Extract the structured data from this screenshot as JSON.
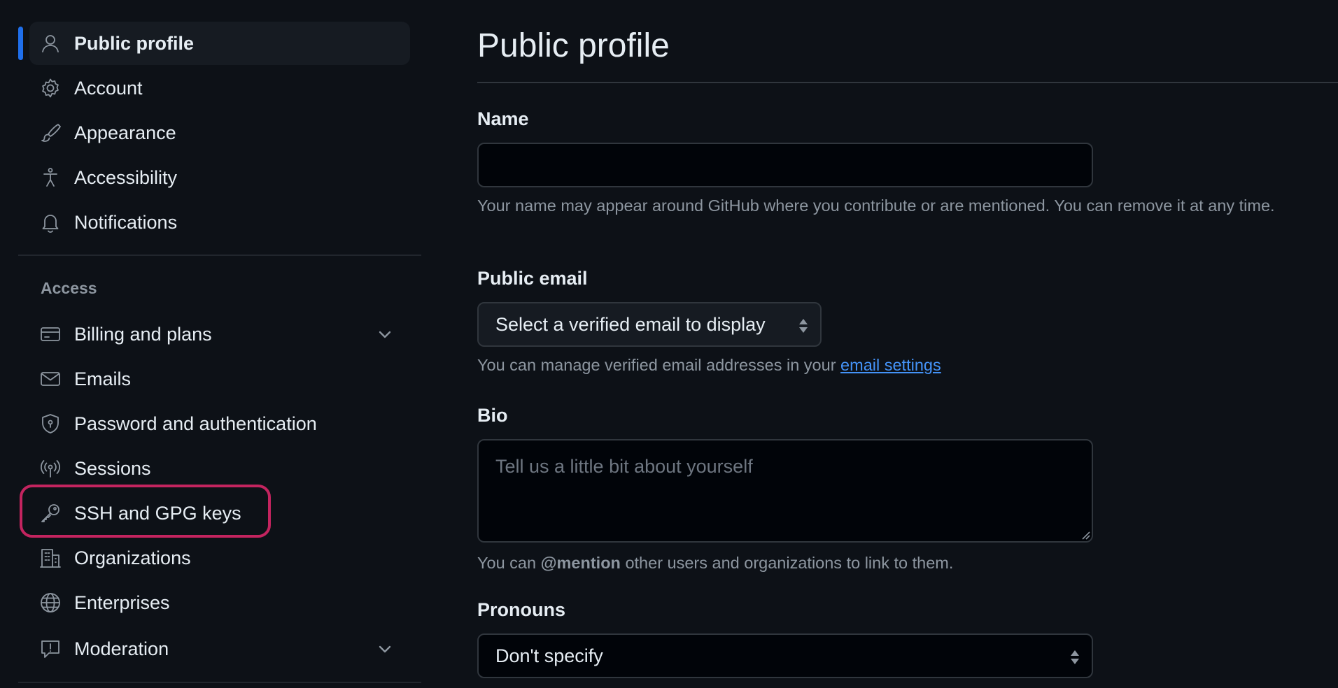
{
  "sidebar": {
    "items": [
      {
        "label": "Public profile",
        "icon": "person-icon",
        "active": true
      },
      {
        "label": "Account",
        "icon": "gear-icon"
      },
      {
        "label": "Appearance",
        "icon": "paintbrush-icon"
      },
      {
        "label": "Accessibility",
        "icon": "accessibility-icon"
      },
      {
        "label": "Notifications",
        "icon": "bell-icon"
      }
    ],
    "access_heading": "Access",
    "access_items": [
      {
        "label": "Billing and plans",
        "icon": "credit-card-icon",
        "has_chevron": true
      },
      {
        "label": "Emails",
        "icon": "mail-icon"
      },
      {
        "label": "Password and authentication",
        "icon": "shield-lock-icon"
      },
      {
        "label": "Sessions",
        "icon": "broadcast-icon"
      },
      {
        "label": "SSH and GPG keys",
        "icon": "key-icon",
        "highlighted": true
      },
      {
        "label": "Organizations",
        "icon": "organization-icon"
      },
      {
        "label": "Enterprises",
        "icon": "globe-icon"
      },
      {
        "label": "Moderation",
        "icon": "report-icon",
        "has_chevron": true
      }
    ]
  },
  "main": {
    "title": "Public profile",
    "name": {
      "label": "Name",
      "value": "",
      "help_text": "Your name may appear around GitHub where you contribute or are mentioned. You can remove it at any time."
    },
    "public_email": {
      "label": "Public email",
      "selected": "Select a verified email to display",
      "help_prefix": "You can manage verified email addresses in your ",
      "help_link": "email settings"
    },
    "bio": {
      "label": "Bio",
      "placeholder": "Tell us a little bit about yourself",
      "help_prefix": "You can ",
      "help_mention": "@mention",
      "help_suffix": " other users and organizations to link to them."
    },
    "pronouns": {
      "label": "Pronouns",
      "selected": "Don't specify"
    }
  },
  "colors": {
    "background": "#0d1117",
    "active_item_bg": "#161b22",
    "active_bar": "#1f6feb",
    "highlight_ring": "#c3245f",
    "link": "#4493f8",
    "muted_text": "#8d96a0"
  }
}
